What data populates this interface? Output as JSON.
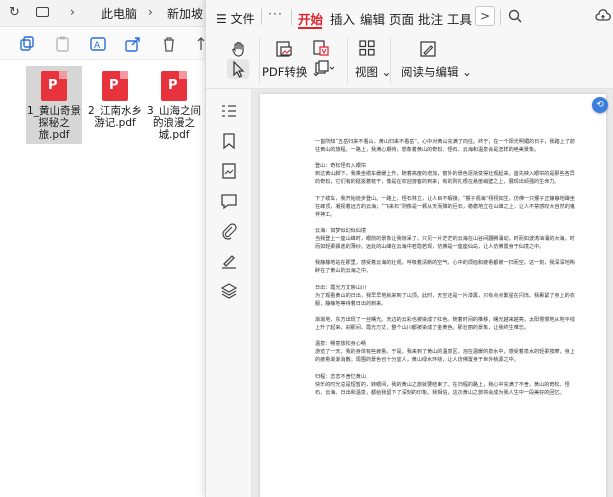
{
  "explorer": {
    "breadcrumb": [
      "此电脑",
      "新加坡 (E"
    ],
    "files": [
      {
        "name": "1_黄山奇景探秘之旅.pdf",
        "selected": true
      },
      {
        "name": "2_江南水乡游记.pdf",
        "selected": false
      },
      {
        "name": "3_山海之间的浪漫之城.pdf",
        "selected": false
      }
    ]
  },
  "app": {
    "menu": {
      "file": "文件",
      "more": "···",
      "tabs": [
        "开始",
        "插入",
        "编辑",
        "页面",
        "批注",
        "工具"
      ],
      "next": ">"
    },
    "ribbon": {
      "pdf_convert": "PDF转换",
      "view": "视图",
      "read_edit": "阅读与编辑"
    }
  },
  "document": {
    "paragraphs": [
      "一首所知“五岳归来不看山，黄山归来不看岳”。心中对黄山充满了向往。终于，在一个阳光明媚的日子，我踏上了前往黄山的旅程。一路上，我满心期待，想象着黄山的奇松、怪石、云海和温泉会是怎样的绝美景象。",
      "登山：奇松怪石入眼帘\n到达黄山脚下，我乘坐缆车缓缓上升。随着高度的增加，窗外的景色逐渐变得壮观起来。首先映入眼帘的是那些各异的奇松，它们有的挺拔着枝干，像是在欢迎游客的到来；有的则扎根在悬崖峭壁之上，展现出顽强的生命力。",
      "下了缆车，我开始徒步登山。一路上，怪石林立，让人目不暇接。“猴子观海”栩栩如生，仿佛一只猴子正静静地蹲坐在峰顶，凝视着远方的云海；“飞来石”则像是一颗从天而降的巨石，稳稳地立在山峰之上，让人不禁感叹大自然的鬼斧神工。",
      "云海：如梦似幻似仙境\n当我登上一座山峰时，眼前的景象让我惊呆了。只见一片茫茫的云海在山谷间翻腾涌动，时而如波涛汹涌的大海，时而如轻柔飘逸的薄纱。远处的山峰在云海中若隐若现，仿佛是一座座仙岛，让人仿佛置身于仙境之中。",
      "我静静地站在那里，感受着云海的壮观，呼吸着清新的空气，心中的烦恼和疲惫都被一扫而空。这一刻，我深深地陶醉在了黄山的云海之中。",
      "日出：霞光万丈映山川\n为了观看黄山的日出，我早早地就来到了山顶。此时，天空还是一片漆黑，只有点点繁星在闪烁。我裹紧了身上的衣服，静静地等待着日出的到来。",
      "渐渐地，东方出现了一丝曙光。天边的云彩也被染成了红色。随着时间的推移，曙光越来越亮，太阳慢慢地从地平线上升了起来，刹那间，霞光万丈，整个山川都被染成了金黄色。那壮丽的景象，让我终生难忘。",
      "温泉：畅意放松身心畅\n游览了一天，我的身体有些疲惫。于是，我来到了黄山的温泉区，泡在温暖的泉水中，感受着泉水的轻柔按摩，身上的疲惫渐渐消散。周围的景色也十分宜人，黄山绿水环绕，让人仿佛置身于世外桃源之中。",
      "归程：恋恋不舍忆黄山\n快乐的时光总是短暂的，转眼间，我的黄山之旅就要结束了。在归程的路上，我心中充满了不舍。黄山的奇松、怪石、云海、日出和温泉，都给我留下了深刻的印象。我相信，这次黄山之旅将会成为我人生中一段美好的回忆。"
    ]
  }
}
